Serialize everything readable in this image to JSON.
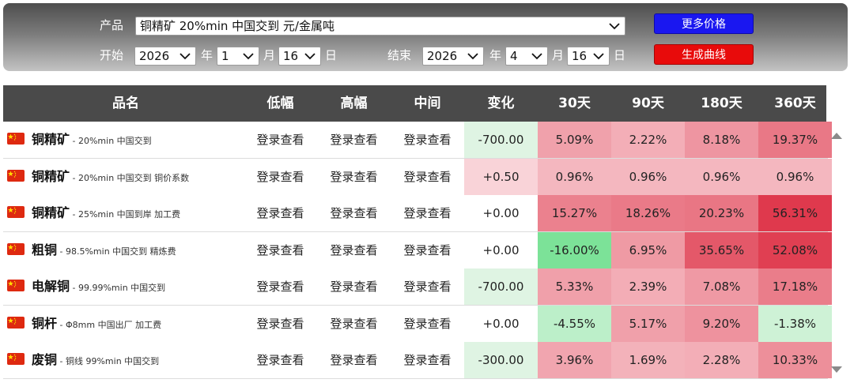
{
  "controls": {
    "product_label": "产品",
    "product_value": "铜精矿 20%min 中国交到 元/金属吨",
    "more_price_label": "更多价格",
    "generate_curve_label": "生成曲线",
    "start_label": "开始",
    "end_label": "结束",
    "year_unit": "年",
    "month_unit": "月",
    "day_unit": "日",
    "start_year": "2026",
    "start_month": "1",
    "start_day": "16",
    "end_year": "2026",
    "end_month": "4",
    "end_day": "16"
  },
  "table": {
    "headers": [
      "品名",
      "低幅",
      "高幅",
      "中间",
      "变化",
      "30天",
      "90天",
      "180天",
      "360天"
    ],
    "rows": [
      {
        "name": "铜精矿",
        "desc": "20%min 中国交到",
        "low": "登录查看",
        "high": "登录查看",
        "mid": "登录查看",
        "change": "-700.00",
        "d30": "5.09%",
        "d90": "2.22%",
        "d180": "8.18%",
        "d360": "19.37%"
      },
      {
        "name": "铜精矿",
        "desc": "20%min 中国交到 铜价系数",
        "low": "登录查看",
        "high": "登录查看",
        "mid": "登录查看",
        "change": "+0.50",
        "d30": "0.96%",
        "d90": "0.96%",
        "d180": "0.96%",
        "d360": "0.96%"
      },
      {
        "name": "铜精矿",
        "desc": "25%min 中国到岸 加工费",
        "low": "登录查看",
        "high": "登录查看",
        "mid": "登录查看",
        "change": "+0.00",
        "d30": "15.27%",
        "d90": "18.26%",
        "d180": "20.23%",
        "d360": "56.31%"
      },
      {
        "name": "粗铜",
        "desc": "98.5%min 中国交到 精炼费",
        "low": "登录查看",
        "high": "登录查看",
        "mid": "登录查看",
        "change": "+0.00",
        "d30": "-16.00%",
        "d90": "6.95%",
        "d180": "35.65%",
        "d360": "52.08%"
      },
      {
        "name": "电解铜",
        "desc": "99.99%min 中国交到",
        "low": "登录查看",
        "high": "登录查看",
        "mid": "登录查看",
        "change": "-700.00",
        "d30": "5.33%",
        "d90": "2.39%",
        "d180": "7.08%",
        "d360": "17.18%"
      },
      {
        "name": "铜杆",
        "desc": "Φ8mm 中国出厂 加工费",
        "low": "登录查看",
        "high": "登录查看",
        "mid": "登录查看",
        "change": "+0.00",
        "d30": "-4.55%",
        "d90": "5.17%",
        "d180": "9.20%",
        "d360": "-1.38%"
      },
      {
        "name": "废铜",
        "desc": "铜线 99%min 中国交到",
        "low": "登录查看",
        "high": "登录查看",
        "mid": "登录查看",
        "change": "-300.00",
        "d30": "3.96%",
        "d90": "1.69%",
        "d180": "2.28%",
        "d360": "10.33%"
      }
    ]
  },
  "icons": {
    "flag": "china-flag-icon",
    "dropdown": "chevron-down-icon",
    "scroll_up": "scroll-up-arrow-icon",
    "scroll_down": "scroll-down-arrow-icon"
  },
  "colors": {
    "header_bg": "#4a4a4a",
    "button_blue": "#1a17f0",
    "button_red": "#e80b0b",
    "change_down_bg": "#dff4e3",
    "change_up_bg": "#f9d3d8",
    "flag_red": "#de2910"
  }
}
